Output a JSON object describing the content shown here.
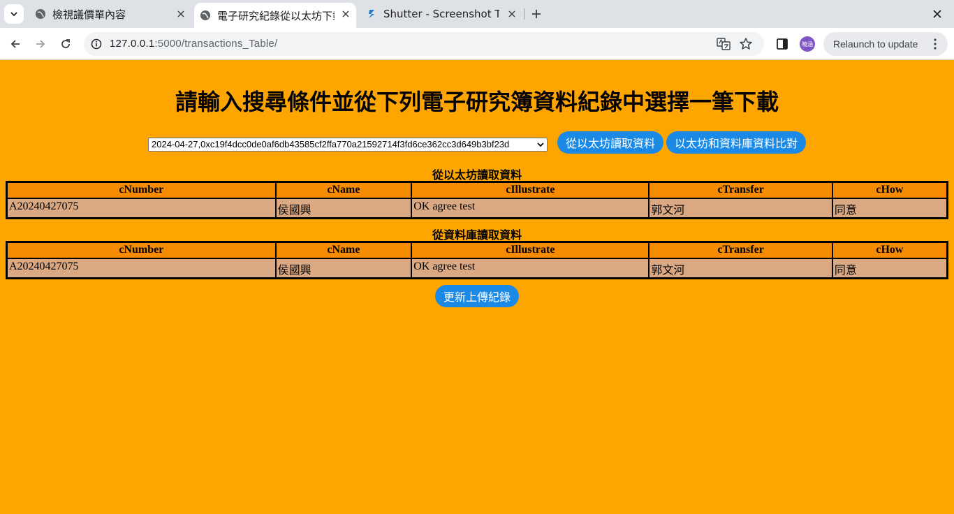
{
  "browser": {
    "tabs": [
      {
        "title": "檢視議價單內容",
        "active": false
      },
      {
        "title": "電子研究紀錄從以太坊下載",
        "active": true
      },
      {
        "title": "Shutter - Screenshot Tool",
        "active": false
      }
    ],
    "url_host": "127.0.0.1",
    "url_path": ":5000/transactions_Table/",
    "profile_label": "曉涵",
    "relaunch_label": "Relaunch to update"
  },
  "page": {
    "heading": "請輸入搜尋條件並從下列電子研究簿資料紀錄中選擇一筆下載",
    "select_value": "2024-04-27,0xc19f4dcc0de0af6db43585cf2ffa770a21592714f3fd6ce362cc3d649b3bf23d",
    "btn_read_eth": "從以太坊讀取資料",
    "btn_compare": "以太坊和資料庫資料比對",
    "btn_update": "更新上傳紀錄",
    "columns": [
      "cNumber",
      "cName",
      "cIllustrate",
      "cTransfer",
      "cHow"
    ],
    "eth_table": {
      "caption": "從以太坊讀取資料",
      "row": [
        "A20240427075",
        "侯國興",
        "OK agree test",
        "郭文河",
        "同意"
      ]
    },
    "db_table": {
      "caption": "從資料庫讀取資料",
      "row": [
        "A20240427075",
        "侯國興",
        "OK agree test",
        "郭文河",
        "同意"
      ]
    }
  },
  "colors": {
    "page_background": "#ffa500",
    "table_header": "#f48b00",
    "table_cell": "#daa882",
    "button_blue": "#1a8ae6"
  }
}
